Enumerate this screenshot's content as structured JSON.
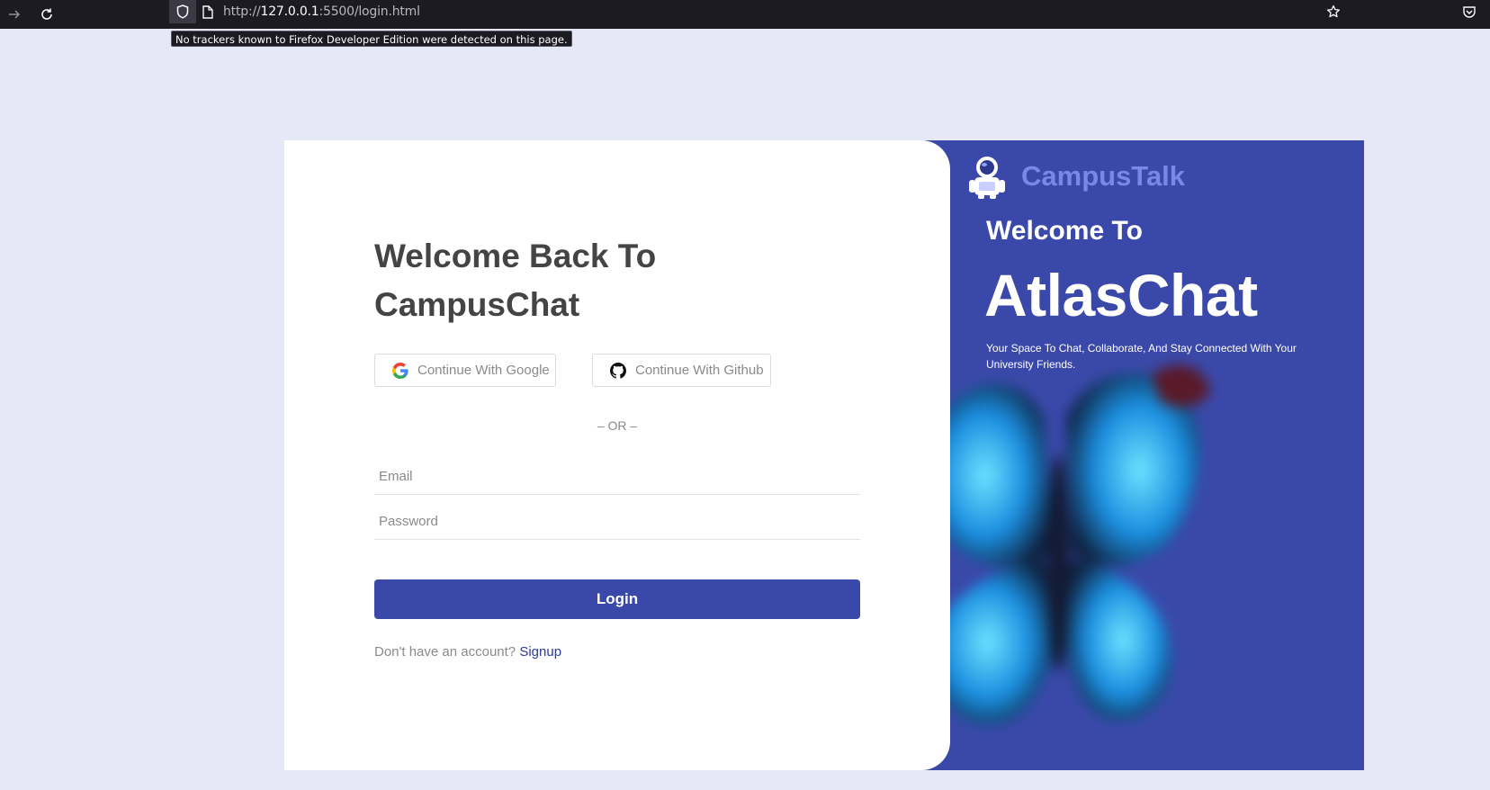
{
  "browser": {
    "url_prefix": "http://",
    "url_host": "127.0.0.1",
    "url_rest": ":5500/login.html",
    "tracker_tooltip": "No trackers known to Firefox Developer Edition were detected on this page.",
    "icons": {
      "forward": "forward-arrow-icon",
      "reload": "reload-icon",
      "shield": "shield-icon",
      "page": "page-icon",
      "bookmark": "star-icon",
      "pocket": "pocket-icon"
    }
  },
  "login": {
    "title_line1": "Welcome Back To",
    "title_line2": "CampusChat",
    "google_label": "Continue With Google",
    "github_label": "Continue With Github",
    "divider": "– OR –",
    "email_placeholder": "Email",
    "password_placeholder": "Password",
    "login_button": "Login",
    "no_account": "Don't have an account?",
    "signup_link": "Signup"
  },
  "promo": {
    "brand": "CampusTalk",
    "welcome": "Welcome To",
    "app_name": "AtlasChat",
    "tagline": "Your Space To Chat, Collaborate, And Stay Connected With Your University Friends."
  },
  "colors": {
    "page_background": "#e6e8f8",
    "accent": "#3a49a9",
    "brand_text": "#7b87e8",
    "title_text": "#444444",
    "link": "#2a3aa0"
  }
}
